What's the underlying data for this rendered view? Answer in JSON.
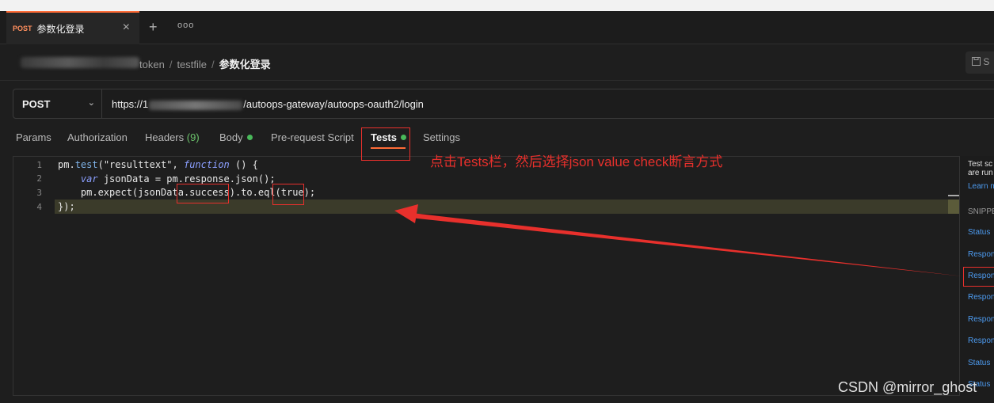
{
  "tab": {
    "method": "POST",
    "title": "参数化登录",
    "close": "×",
    "add": "+",
    "more": "ooo"
  },
  "breadcrumb": {
    "part1": "token",
    "part2": "testfile",
    "current": "参数化登录",
    "sep": "/"
  },
  "save_label": "S",
  "request": {
    "method": "POST",
    "url_prefix": "https://1",
    "url_suffix": "/autoops-gateway/autoops-oauth2/login"
  },
  "request_tabs": {
    "params": "Params",
    "authorization": "Authorization",
    "headers": "Headers",
    "headers_count": "(9)",
    "body": "Body",
    "prerequest": "Pre-request Script",
    "tests": "Tests",
    "settings": "Settings"
  },
  "editor": {
    "line_numbers": [
      "1",
      "2",
      "3",
      "4"
    ],
    "line1": {
      "a": "pm.",
      "b": "test",
      "c": "(\"resulttext\", ",
      "d": "function",
      "e": " () {"
    },
    "line2": {
      "a": "    ",
      "b": "var",
      "c": " jsonData = pm.response.json();"
    },
    "line3": "    pm.expect(jsonData.success).to.eql(true);",
    "line4": "});"
  },
  "annotation": "点击Tests栏，然后选择json value check断言方式",
  "sidebar": {
    "desc_line1": "Test sc",
    "desc_line2": "are run",
    "learn": "Learn m",
    "snippets_title": "SNIPPE",
    "items": [
      "Status",
      "Respon",
      "Respon",
      "Respon",
      "Respon",
      "Respon",
      "Status",
      "Status"
    ]
  },
  "watermark": "CSDN @mirror_ghost",
  "colors": {
    "accent": "#ff6c37",
    "annotation": "#e8302c",
    "link": "#4d9bf0",
    "dot": "#49b95a"
  }
}
